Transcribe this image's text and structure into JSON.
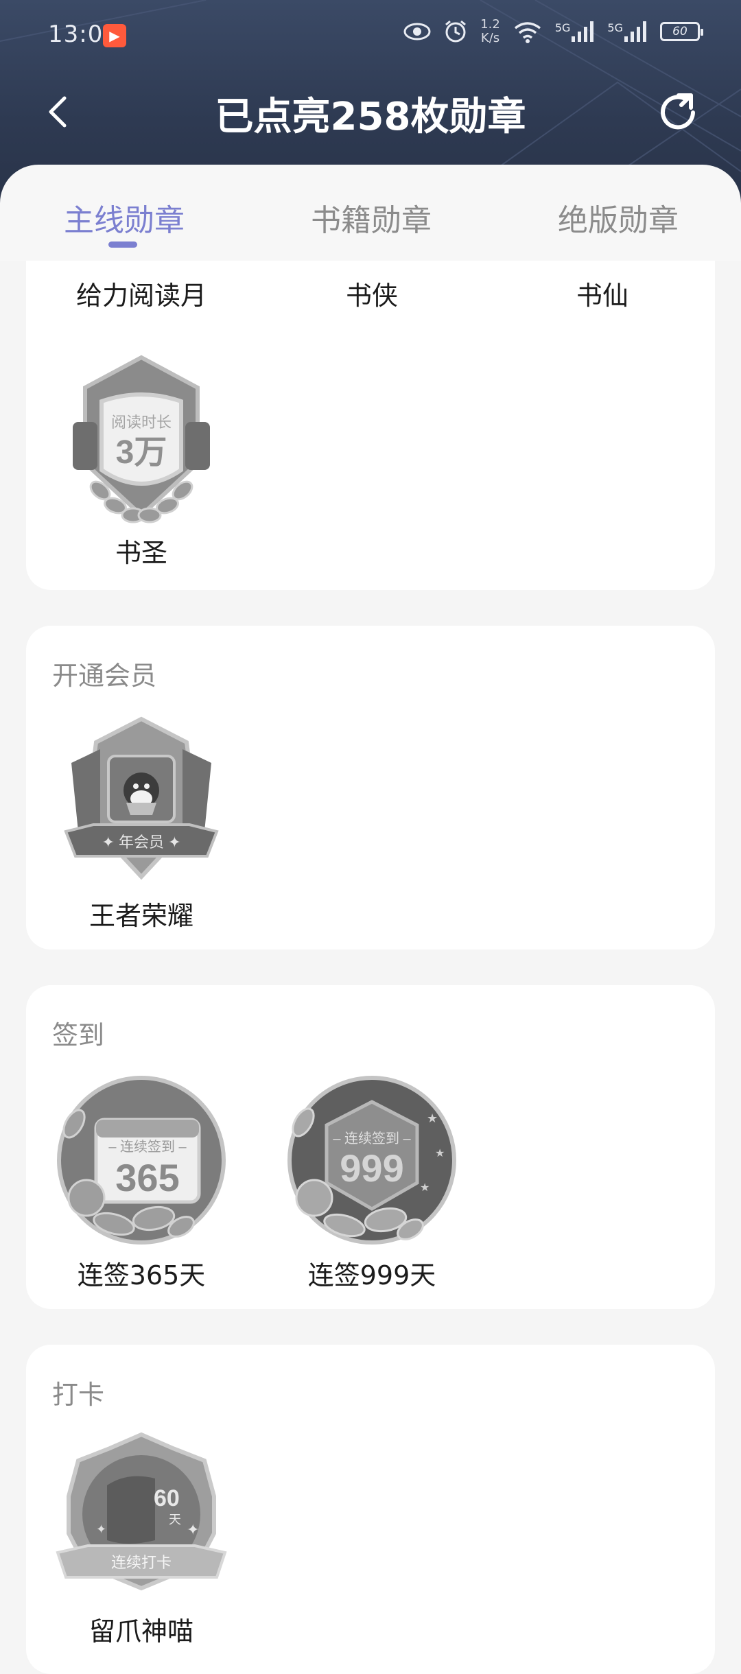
{
  "status_bar": {
    "time": "13:00",
    "net_speed_top": "1.2",
    "net_speed_bottom": "K/s",
    "signal_1": "5G",
    "signal_2": "5G",
    "battery": "60"
  },
  "header": {
    "title": "已点亮258枚勋章"
  },
  "tabs": [
    {
      "label": "主线勋章",
      "active": true
    },
    {
      "label": "书籍勋章",
      "active": false
    },
    {
      "label": "绝版勋章",
      "active": false
    }
  ],
  "sections": {
    "reading": {
      "top_labels": [
        "给力阅读月",
        "书侠",
        "书仙"
      ],
      "badges": [
        {
          "label": "书圣",
          "line1": "阅读时长",
          "line2": "3万"
        }
      ]
    },
    "vip": {
      "title": "开通会员",
      "badges": [
        {
          "label": "王者荣耀",
          "ribbon": "✦ 年会员 ✦"
        }
      ]
    },
    "checkin": {
      "title": "签到",
      "badges": [
        {
          "label": "连签365天",
          "top": "– 连续签到 –",
          "num": "365"
        },
        {
          "label": "连签999天",
          "top": "– 连续签到 –",
          "num": "999"
        }
      ]
    },
    "punch": {
      "title": "打卡",
      "badges": [
        {
          "label": "留爪神喵",
          "num": "60",
          "unit": "天",
          "ribbon": "连续打卡"
        }
      ]
    }
  },
  "colors": {
    "accent": "#7b7fd0",
    "header_bg": "#2e3a52",
    "badge_gray": "#8e8e8e"
  }
}
